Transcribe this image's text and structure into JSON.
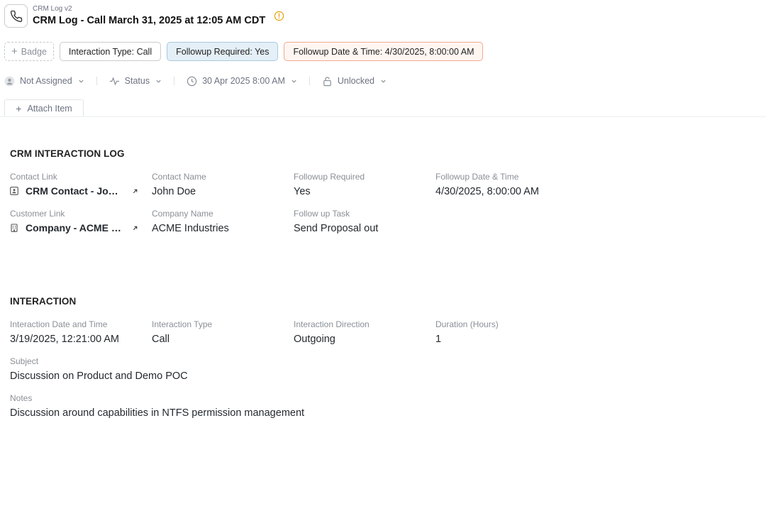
{
  "header": {
    "subtitle": "CRM Log v2",
    "title": "CRM Log - Call March 31, 2025 at 12:05 AM CDT"
  },
  "badges": {
    "add_label": "Badge",
    "items": [
      {
        "label": "Interaction Type: Call"
      },
      {
        "label": "Followup Required: Yes"
      },
      {
        "label": "Followup Date & Time: 4/30/2025, 8:00:00 AM"
      }
    ]
  },
  "meta": {
    "assignee": "Not Assigned",
    "status": "Status",
    "date": "30 Apr 2025 8:00 AM",
    "lock": "Unlocked"
  },
  "attach_label": "Attach Item",
  "crm_section": {
    "title": "CRM INTERACTION LOG",
    "contact_link": {
      "label": "Contact Link",
      "value": "CRM Contact - John Doe"
    },
    "contact_name": {
      "label": "Contact Name",
      "value": "John Doe"
    },
    "followup_required": {
      "label": "Followup Required",
      "value": "Yes"
    },
    "followup_date": {
      "label": "Followup Date & Time",
      "value": "4/30/2025, 8:00:00 AM"
    },
    "customer_link": {
      "label": "Customer Link",
      "value": "Company - ACME Industries"
    },
    "company_name": {
      "label": "Company Name",
      "value": "ACME Industries"
    },
    "followup_task": {
      "label": "Follow up Task",
      "value": "Send Proposal out"
    }
  },
  "interaction_section": {
    "title": "INTERACTION",
    "date_time": {
      "label": "Interaction Date and Time",
      "value": "3/19/2025, 12:21:00 AM"
    },
    "type": {
      "label": "Interaction Type",
      "value": "Call"
    },
    "direction": {
      "label": "Interaction Direction",
      "value": "Outgoing"
    },
    "duration": {
      "label": "Duration (Hours)",
      "value": "1"
    },
    "subject": {
      "label": "Subject",
      "value": "Discussion on Product and Demo POC"
    },
    "notes": {
      "label": "Notes",
      "value": "Discussion around capabilities in NTFS permission management"
    }
  },
  "icons": {
    "app": "phone-icon",
    "warning": "warning-circle-icon",
    "assignee": "user-avatar-icon",
    "status": "activity-icon",
    "date": "clock-icon",
    "lock": "unlock-icon",
    "contact": "contact-card-icon",
    "customer": "building-icon",
    "open_link": "arrow-up-right-icon"
  },
  "colors": {
    "warning": "#e6a817",
    "badge_blue_bg": "#e4eff7",
    "badge_orange_border": "#f2a98e"
  }
}
